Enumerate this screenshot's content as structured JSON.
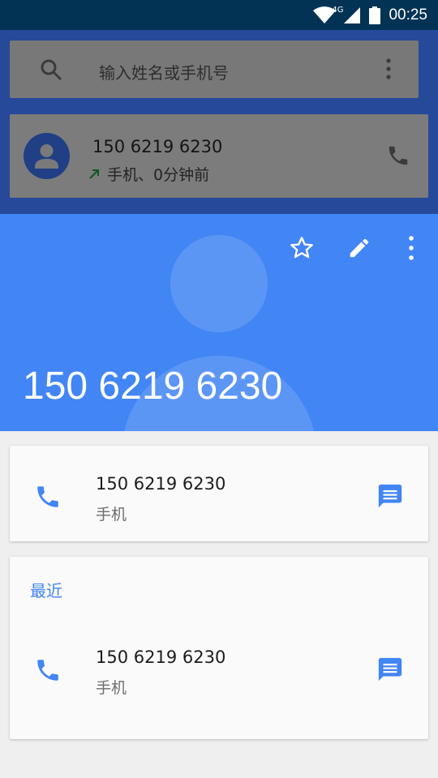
{
  "status_bar": {
    "network_label": "4G",
    "time": "00:25"
  },
  "search": {
    "placeholder": "输入姓名或手机号"
  },
  "recent_call": {
    "number": "150 6219 6230",
    "detail": "手机、0分钟前"
  },
  "contact": {
    "name": "150 6219 6230"
  },
  "phone_card": {
    "number": "150 6219 6230",
    "type_label": "手机"
  },
  "recent_card": {
    "title": "最近",
    "number": "150 6219 6230",
    "type_label": "手机"
  },
  "colors": {
    "accent": "#4285f4",
    "status_bar": "#033354",
    "dim_background": "#26499a",
    "outgoing_arrow": "#1a8a3a"
  },
  "icons": {
    "status": [
      "wifi-icon",
      "signal-icon",
      "battery-icon"
    ],
    "search": "search-icon",
    "overflow": "more-vert-icon",
    "header_actions": [
      "star-icon",
      "edit-icon",
      "more-vert-icon"
    ],
    "call": "phone-icon",
    "message": "message-icon",
    "call_direction": "outgoing-arrow-icon"
  }
}
